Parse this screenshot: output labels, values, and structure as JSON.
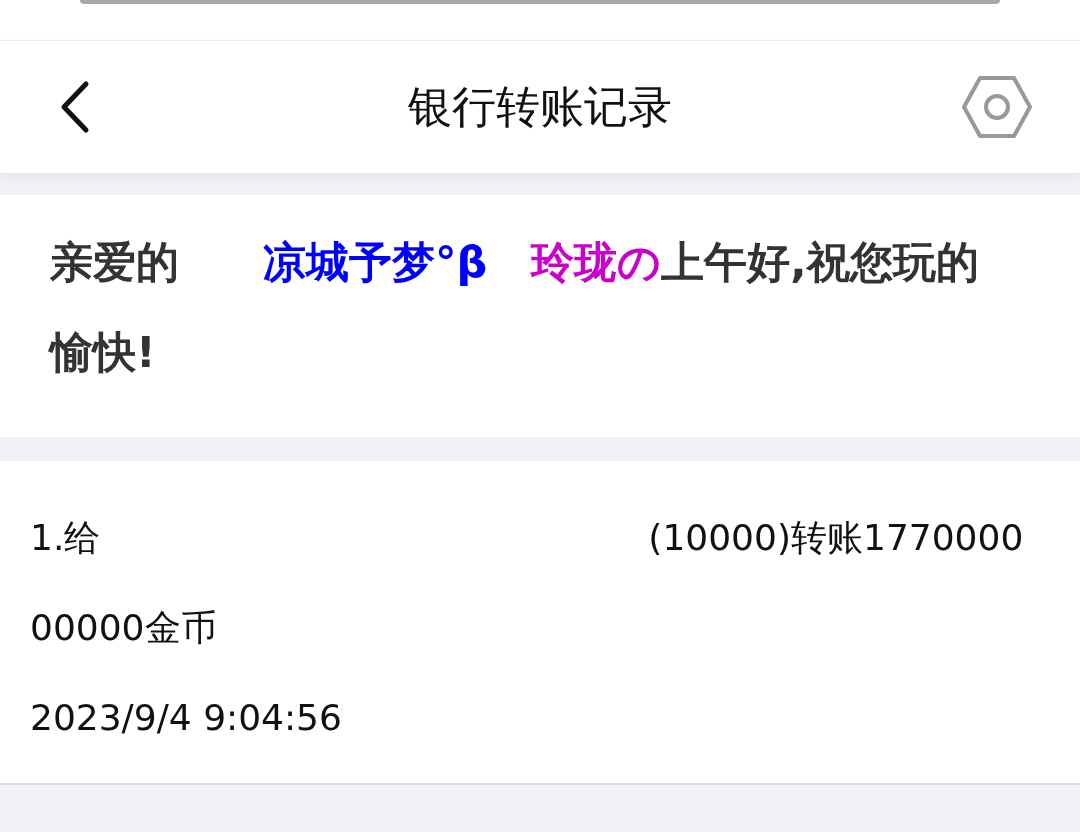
{
  "header": {
    "title": "银行转账记录"
  },
  "greeting": {
    "prefix": "亲爱的",
    "names": [
      {
        "text": "凉城予梦°β",
        "color": "#0000ff"
      },
      {
        "text": "玲珑の",
        "color": "#cc00cc"
      }
    ],
    "suffix": "上午好,祝您玩的愉快!"
  },
  "records": [
    {
      "prefix": "1.给",
      "detail": "(10000)转账177000000000金币",
      "time": "2023/9/4 9:04:56"
    }
  ]
}
